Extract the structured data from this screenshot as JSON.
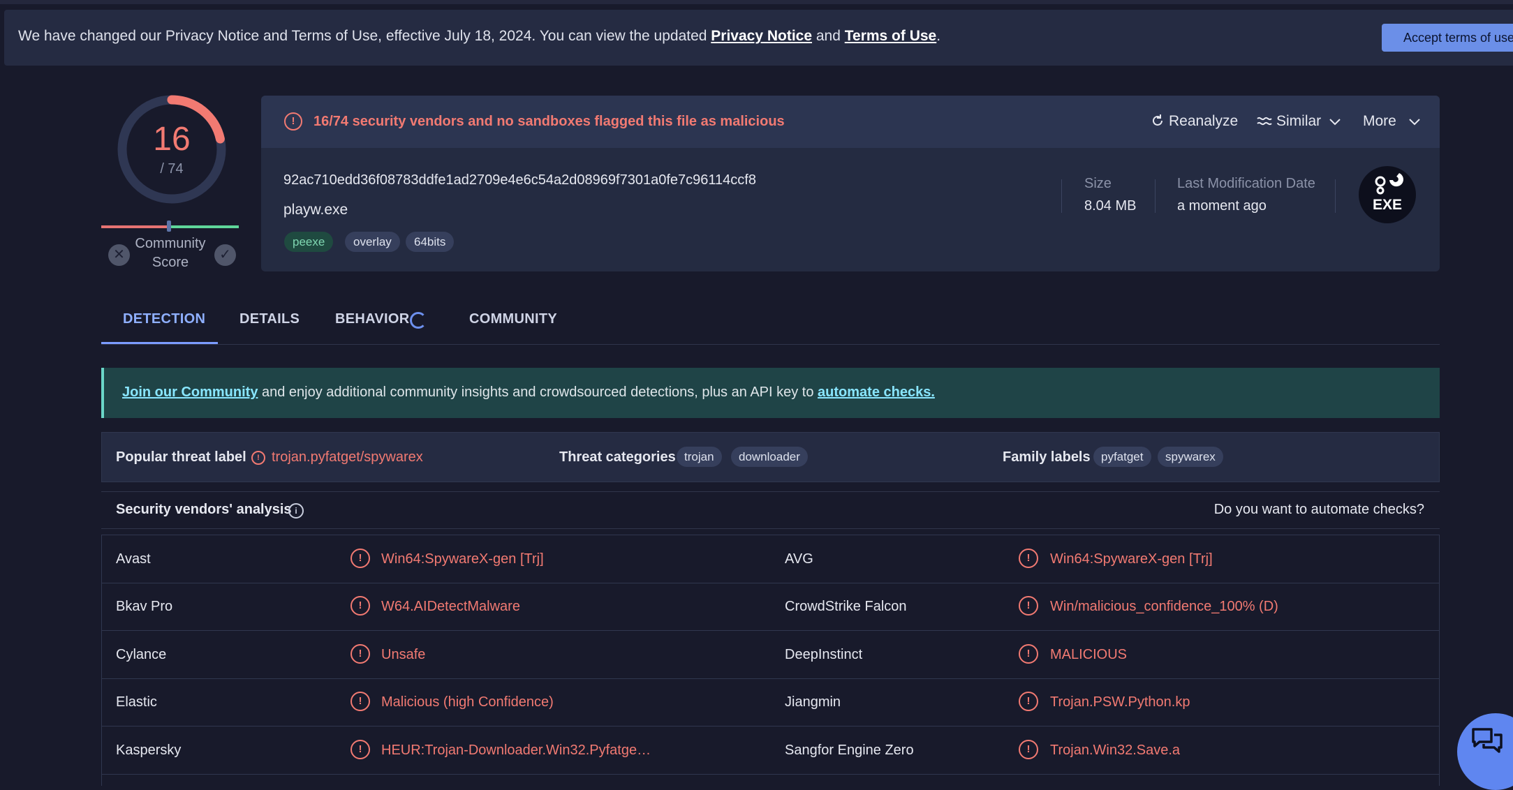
{
  "privacy_banner": {
    "text_before": "We have changed our Privacy Notice and Terms of Use, effective July 18, 2024. You can view the updated ",
    "privacy_link": "Privacy Notice",
    "and_text": " and ",
    "terms_link": "Terms of Use",
    "period": ".",
    "accept_label": "Accept terms of use"
  },
  "score": {
    "detections": "16",
    "total": "/ 74",
    "detection_fraction": 0.216,
    "community_label_1": "Community",
    "community_label_2": "Score"
  },
  "file": {
    "alert": "16/74 security vendors and no sandboxes flagged this file as malicious",
    "actions": {
      "reanalyze": "Reanalyze",
      "similar": "Similar",
      "more": "More"
    },
    "hash": "92ac710edd36f08783ddfe1ad2709e4e6c54a2d08969f7301a0fe7c96114ccf8",
    "name": "playw.exe",
    "tags": [
      "peexe",
      "overlay",
      "64bits"
    ],
    "size_label": "Size",
    "size_value": "8.04 MB",
    "modified_label": "Last Modification Date",
    "modified_value": "a moment ago",
    "type_badge": "EXE"
  },
  "tabs": [
    "DETECTION",
    "DETAILS",
    "BEHAVIOR",
    "COMMUNITY"
  ],
  "join": {
    "link1": "Join our Community",
    "middle": " and enjoy additional community insights and crowdsourced detections, plus an API key to ",
    "link2": "automate checks."
  },
  "threat": {
    "popular_label": "Popular threat label",
    "popular_value": "trojan.pyfatget/spywarex",
    "categories_label": "Threat categories",
    "categories": [
      "trojan",
      "downloader"
    ],
    "family_label": "Family labels",
    "families": [
      "pyfatget",
      "spywarex"
    ]
  },
  "vendors": {
    "title": "Security vendors' analysis",
    "automate_question": "Do you want to automate checks?",
    "rows": [
      {
        "left_name": "Avast",
        "left_result": "Win64:SpywareX-gen [Trj]",
        "right_name": "AVG",
        "right_result": "Win64:SpywareX-gen [Trj]"
      },
      {
        "left_name": "Bkav Pro",
        "left_result": "W64.AIDetectMalware",
        "right_name": "CrowdStrike Falcon",
        "right_result": "Win/malicious_confidence_100% (D)"
      },
      {
        "left_name": "Cylance",
        "left_result": "Unsafe",
        "right_name": "DeepInstinct",
        "right_result": "MALICIOUS"
      },
      {
        "left_name": "Elastic",
        "left_result": "Malicious (high Confidence)",
        "right_name": "Jiangmin",
        "right_result": "Trojan.PSW.Python.kp"
      },
      {
        "left_name": "Kaspersky",
        "left_result": "HEUR:Trojan-Downloader.Win32.Pyfatge…",
        "right_name": "Sangfor Engine Zero",
        "right_result": "Trojan.Win32.Save.a"
      }
    ]
  },
  "colors": {
    "accent_blue": "#7c9cff",
    "malicious_red": "#f27a72",
    "background": "#181a2b"
  }
}
